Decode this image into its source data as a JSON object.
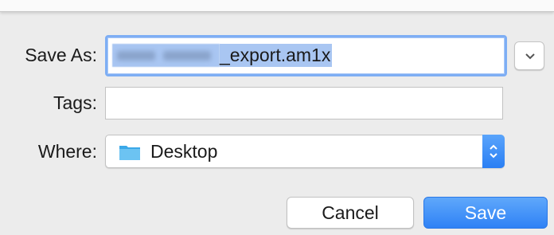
{
  "dialog": {
    "save_as_label": "Save As:",
    "filename_visible_suffix": "_export.am1x",
    "tags_label": "Tags:",
    "tags_value": "",
    "where_label": "Where:",
    "where_value": "Desktop",
    "cancel_label": "Cancel",
    "save_label": "Save"
  },
  "icons": {
    "expand": "chevron-down-icon",
    "location": "folder-icon",
    "stepper": "up-down-stepper-icon"
  },
  "colors": {
    "accent": "#2f82f5",
    "selection": "#a9c6f2",
    "focus_ring": "#7eaef4",
    "folder": "#3ba8e8"
  }
}
